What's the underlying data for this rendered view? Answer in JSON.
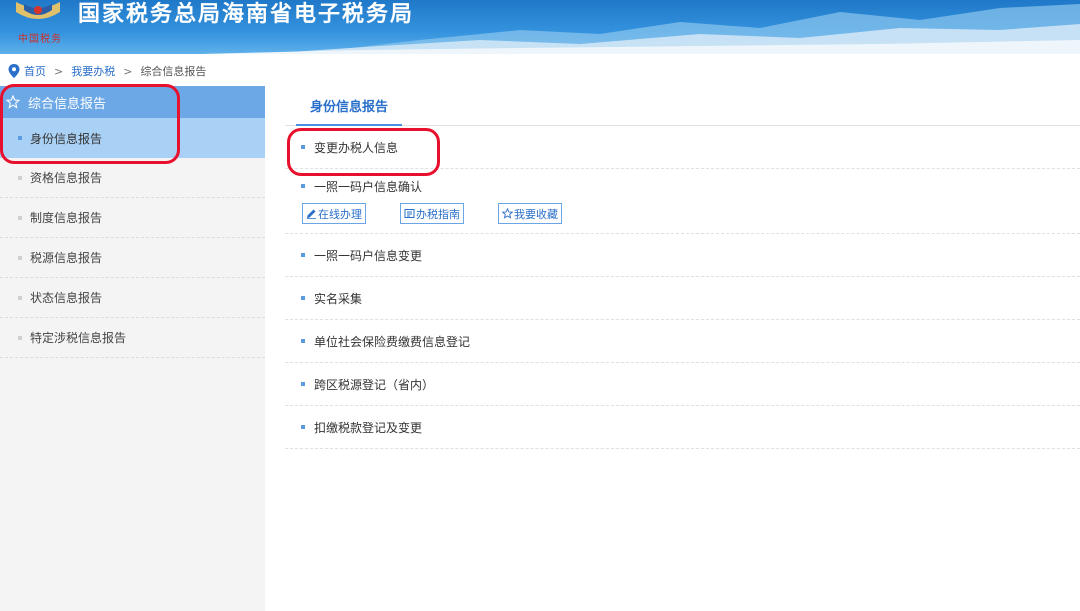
{
  "header": {
    "title": "国家税务总局海南省电子税务局",
    "seal_text": "中国税务"
  },
  "breadcrumb": {
    "items": [
      "首页",
      "我要办税",
      "综合信息报告"
    ],
    "separator": ">"
  },
  "sidebar": {
    "title": "综合信息报告",
    "items": [
      {
        "label": "身份信息报告",
        "active": true
      },
      {
        "label": "资格信息报告",
        "active": false
      },
      {
        "label": "制度信息报告",
        "active": false
      },
      {
        "label": "税源信息报告",
        "active": false
      },
      {
        "label": "状态信息报告",
        "active": false
      },
      {
        "label": "特定涉税信息报告",
        "active": false
      }
    ]
  },
  "main": {
    "tab": "身份信息报告",
    "items": [
      {
        "label": "变更办税人信息"
      },
      {
        "label": "一照一码户信息确认"
      },
      {
        "label": "一照一码户信息变更"
      },
      {
        "label": "实名采集"
      },
      {
        "label": "单位社会保险费缴费信息登记"
      },
      {
        "label": "跨区税源登记（省内）"
      },
      {
        "label": "扣缴税款登记及变更"
      }
    ],
    "actions": {
      "online": "在线办理",
      "guide": "办税指南",
      "favorite": "我要收藏"
    }
  },
  "colors": {
    "accent": "#2a6fc9",
    "sidebar_header": "#6ca8e6",
    "sidebar_active": "#a9d0f5",
    "annotation": "#e8112d"
  },
  "icons": {
    "location": "location-pin-icon",
    "star": "star-icon",
    "edit": "pencil-icon",
    "guide": "guide-icon",
    "favorite": "star-outline-icon"
  }
}
